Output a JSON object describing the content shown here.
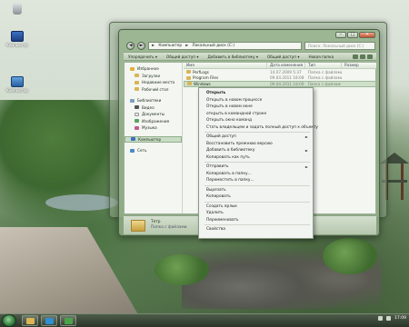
{
  "desktop": {
    "icons": [
      {
        "label": "Компьютер",
        "icon": "computer-icon"
      },
      {
        "label": "Корзина",
        "icon": "recycle-bin-icon"
      },
      {
        "label": "Компьютер",
        "icon": "computer-icon"
      }
    ]
  },
  "window": {
    "controls": {
      "minimize": "‒",
      "maximize": "□",
      "close": "✕"
    },
    "nav": {
      "back": "◄",
      "forward": "►"
    },
    "address": {
      "parts": [
        "Компьютер",
        "Локальный диск (C:)"
      ],
      "separator": "►"
    },
    "search_placeholder": "Поиск: Локальный диск (C:)",
    "toolbar": [
      "Упорядочить ▾",
      "Общий доступ ▾",
      "Добавить в библиотеку ▾",
      "Общий доступ ▾",
      "Новая папка"
    ],
    "sidebar": [
      {
        "label": "Избранное",
        "icon": "star-icon",
        "type": "group"
      },
      {
        "label": "Загрузки",
        "icon": "folder-icon",
        "type": "sub"
      },
      {
        "label": "Недавние места",
        "icon": "folder-icon",
        "type": "sub"
      },
      {
        "label": "Рабочий стол",
        "icon": "folder-icon",
        "type": "sub"
      },
      {
        "label": "Библиотеки",
        "icon": "library-icon",
        "type": "group"
      },
      {
        "label": "Видео",
        "icon": "video-icon",
        "type": "sub"
      },
      {
        "label": "Документы",
        "icon": "documents-icon",
        "type": "sub"
      },
      {
        "label": "Изображения",
        "icon": "pictures-icon",
        "type": "sub"
      },
      {
        "label": "Музыка",
        "icon": "music-icon",
        "type": "sub"
      },
      {
        "label": "Компьютер",
        "icon": "computer-icon",
        "type": "group",
        "selected": true
      },
      {
        "label": "Сеть",
        "icon": "network-icon",
        "type": "group"
      }
    ],
    "columns": [
      "Имя",
      "Дата изменения",
      "Тип",
      "Размер"
    ],
    "files": [
      {
        "name": "PerfLogs",
        "date": "14.07.2009 5:37",
        "type": "Папка с файлами",
        "size": ""
      },
      {
        "name": "Program Files",
        "date": "09.04.2011 18:08",
        "type": "Папка с файлами",
        "size": ""
      },
      {
        "name": "Windows",
        "date": "09.04.2011 18:09",
        "type": "Папка с файлами",
        "size": "",
        "selected": true
      }
    ],
    "details": {
      "name": "Тетр",
      "type": "Папка с файлами"
    }
  },
  "context_menu": {
    "groups": [
      [
        {
          "label": "Открыть",
          "bold": true
        },
        {
          "label": "Открыть в новом процессе"
        },
        {
          "label": "Открыть в новом окне"
        },
        {
          "label": "открыть в командной строке"
        },
        {
          "label": "Открыть окно команд"
        },
        {
          "label": "Стать владельцем и задать полный доступ к объекту"
        }
      ],
      [
        {
          "label": "Общий доступ",
          "submenu": true
        },
        {
          "label": "Восстановить прежнюю версию"
        },
        {
          "label": "Добавить в библиотеку",
          "submenu": true
        },
        {
          "label": "Копировать как путь"
        }
      ],
      [
        {
          "label": "Отправить",
          "submenu": true
        },
        {
          "label": "Копировать в папку..."
        },
        {
          "label": "Переместить в папку..."
        }
      ],
      [
        {
          "label": "Вырезать"
        },
        {
          "label": "Копировать"
        }
      ],
      [
        {
          "label": "Создать ярлык"
        },
        {
          "label": "Удалить"
        },
        {
          "label": "Переименовать"
        }
      ],
      [
        {
          "label": "Свойства"
        }
      ]
    ],
    "submenu_arrow": "►"
  },
  "taskbar": {
    "time": "17:09",
    "buttons": [
      {
        "icon": "explorer-icon",
        "color": "#d9b556"
      },
      {
        "icon": "media-player-icon",
        "color": "#2f8fd0"
      },
      {
        "icon": "media-center-icon",
        "color": "#4aa24a"
      }
    ]
  }
}
